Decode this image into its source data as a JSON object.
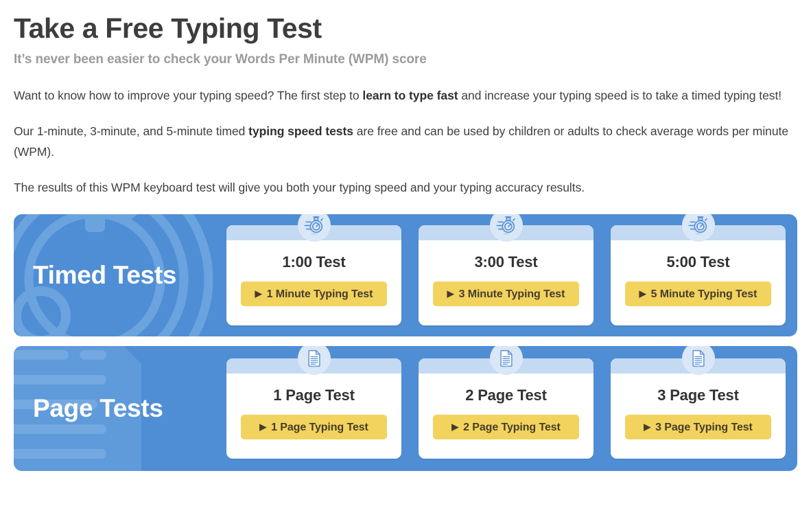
{
  "header": {
    "title": "Take a Free Typing Test",
    "subtitle": "It’s never been easier to check your Words Per Minute (WPM) score"
  },
  "intro": {
    "paragraph1_part1": "Want to know how to improve your typing speed? The first step to ",
    "paragraph1_bold": "learn to type fast",
    "paragraph1_part2": " and increase your typing speed is to take a timed typing test!",
    "paragraph2_part1": "Our 1-minute, 3-minute, and 5-minute timed ",
    "paragraph2_bold": "typing speed tests",
    "paragraph2_part2": " are free and can be used by children or adults to check average words per minute (WPM).",
    "paragraph3": "The results of this WPM keyboard test will give you both your typing speed and your typing accuracy results."
  },
  "panels": [
    {
      "label": "Timed Tests",
      "watermark_icon": "stopwatch-watermark",
      "cards": [
        {
          "icon": "stopwatch-icon",
          "title": "1:00 Test",
          "button_label": "1 Minute Typing Test"
        },
        {
          "icon": "stopwatch-icon",
          "title": "3:00 Test",
          "button_label": "3 Minute Typing Test"
        },
        {
          "icon": "stopwatch-icon",
          "title": "5:00 Test",
          "button_label": "5 Minute Typing Test"
        }
      ]
    },
    {
      "label": "Page Tests",
      "watermark_icon": "document-watermark",
      "cards": [
        {
          "icon": "document-icon",
          "title": "1 Page Test",
          "button_label": "1 Page Typing Test"
        },
        {
          "icon": "document-icon",
          "title": "2 Page Test",
          "button_label": "2 Page Typing Test"
        },
        {
          "icon": "document-icon",
          "title": "3 Page Test",
          "button_label": "3 Page Typing Test"
        }
      ]
    }
  ],
  "icons": {
    "play_triangle": "▶"
  },
  "colors": {
    "panel_blue": "#4f8ed4",
    "card_strip_blue": "#c4daf2",
    "icon_bubble_blue": "#d9e7f7",
    "button_yellow": "#f2d35d",
    "button_text": "#463d2c",
    "title_dark": "#3d3d3d",
    "subtitle_gray": "#9b9b9b"
  }
}
